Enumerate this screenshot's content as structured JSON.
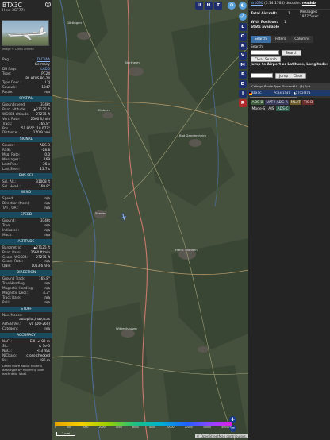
{
  "left_panel": {
    "callsign": "BTX3C",
    "hex_label": "Hex:",
    "hex": "3CF774",
    "photo_credit": "Image © Lukas Schmid",
    "rows_top": [
      {
        "k": "Reg.:",
        "v": "D-CVAA",
        "link": true
      },
      {
        "k": "",
        "v": "Germany"
      },
      {
        "k": "DB flags:",
        "v": "LADD",
        "link": true
      },
      {
        "k": "Type:",
        "v": "PC24"
      },
      {
        "k": "",
        "v": "PILATUS PC-24"
      },
      {
        "k": "Type Desc.:",
        "v": "L2J"
      },
      {
        "k": "Squawk:",
        "v": "1347"
      },
      {
        "k": "Route:",
        "v": "n/a"
      }
    ],
    "sections": [
      {
        "title": "SPATIAL",
        "rows": [
          {
            "k": "Groundspeed:",
            "v": "374kt"
          },
          {
            "k": "Baro. altitude:",
            "v": "▲27125 ft"
          },
          {
            "k": "WGS84 altitude:",
            "v": "27275 ft"
          },
          {
            "k": "Vert. Rate:",
            "v": "2560 ft/min"
          },
          {
            "k": "Track:",
            "v": "165.8°"
          },
          {
            "k": "Pos.:",
            "v": "51.865°, 10.077°"
          },
          {
            "k": "Distance:",
            "v": "170.9 nmi"
          }
        ]
      },
      {
        "title": "SIGNAL",
        "rows": [
          {
            "k": "Source:",
            "v": "ADS-B"
          },
          {
            "k": "RSSI:",
            "v": "-28.8"
          },
          {
            "k": "Msg. Rate:",
            "v": "0.0"
          },
          {
            "k": "Messages:",
            "v": "169"
          },
          {
            "k": "Last Pos.:",
            "v": "25 s"
          },
          {
            "k": "Last Seen:",
            "v": "13.7 s"
          }
        ]
      },
      {
        "title": "FMS SEL",
        "rows": [
          {
            "k": "Sel. Alt.:",
            "v": "31008 ft"
          },
          {
            "k": "Sel. Head.:",
            "v": "169.8°"
          }
        ]
      },
      {
        "title": "WIND",
        "rows": [
          {
            "k": "Speed:",
            "v": "n/a"
          },
          {
            "k": "Direction (from):",
            "v": "n/a"
          },
          {
            "k": "TAT / OAT:",
            "v": "n/a"
          }
        ]
      },
      {
        "title": "SPEED",
        "rows": [
          {
            "k": "Ground:",
            "v": "374kt"
          },
          {
            "k": "True:",
            "v": "n/a"
          },
          {
            "k": "Indicated:",
            "v": "n/a"
          },
          {
            "k": "Mach:",
            "v": "n/a"
          }
        ]
      },
      {
        "title": "ALTITUDE",
        "rows": [
          {
            "k": "Barometric:",
            "v": "▲27125 ft"
          },
          {
            "k": "Baro. Rate:",
            "v": "2560 ft/min"
          },
          {
            "k": "Geom. WGS84:",
            "v": "27275 ft"
          },
          {
            "k": "Geom. Rate:",
            "v": "n/a"
          },
          {
            "k": "QNH:",
            "v": "1013.6 hPa"
          }
        ]
      },
      {
        "title": "DIRECTION",
        "rows": [
          {
            "k": "Ground Track:",
            "v": "165.8°"
          },
          {
            "k": "True Heading:",
            "v": "n/a"
          },
          {
            "k": "Magnetic Heading:",
            "v": "n/a"
          },
          {
            "k": "Magnetic Decl.:",
            "v": "4.3°"
          },
          {
            "k": "Track Rate:",
            "v": "n/a"
          },
          {
            "k": "Roll:",
            "v": "n/a"
          }
        ]
      },
      {
        "title": "STUFF",
        "rows": [
          {
            "k": "Nav. Modes:",
            "v": ""
          },
          {
            "k": "",
            "v": "autopilot,lnav,tcas"
          },
          {
            "k": "ADS-B Ver.:",
            "v": "v0 (DO-260)"
          },
          {
            "k": "Category:",
            "v": "n/a"
          }
        ]
      },
      {
        "title": "ACCURACY",
        "rows": [
          {
            "k": "NACₚ:",
            "v": "EPU < 92 m"
          },
          {
            "k": "SIL:",
            "v": "≤ 1e-5"
          },
          {
            "k": "NACᵥ:",
            "v": "< 3 m/s"
          },
          {
            "k": "NICbaro:",
            "v": "cross-checked"
          },
          {
            "k": "Rc:",
            "v": "186 m"
          }
        ]
      }
    ],
    "footer_note": "Learn more about Mode S data type by hovering over each data label."
  },
  "map": {
    "buttons_top": [
      "U",
      "H",
      "T"
    ],
    "buttons_side": [
      "L",
      "O",
      "K",
      "M",
      "P",
      "I",
      "R"
    ],
    "buttons_side2": [
      "V",
      "D"
    ],
    "legend_ticks": [
      "0",
      "500",
      "1000",
      "2000",
      "4000",
      "6000",
      "8000",
      "10000",
      "20000",
      "30000",
      "40000+"
    ],
    "scale_label": "2 nmi",
    "attribution": "© OpenStreetMap contributors.",
    "zoom_in": "+",
    "zoom_out": "−",
    "places": [
      "Göttingen",
      "Northeim",
      "Einbeck",
      "Bad Gandersheim",
      "Seesen",
      "Hann. Münden",
      "Witzenhausen"
    ]
  },
  "right_panel": {
    "decoder_link": "ar1090",
    "decoder_text": "(3.14.1768) decoder:",
    "decoder_status": "readsb",
    "stats": {
      "total_aircraft_label": "Total Aircraft:",
      "total_aircraft": "1",
      "messages_label": "Messages:",
      "messages": "1977.5/sec",
      "with_position_label": "With Position:",
      "with_position": "1",
      "stats_label": "Stats available"
    },
    "tabs": [
      "Search",
      "Filters",
      "Columns"
    ],
    "search_label": "Search:",
    "search_button": "Search",
    "clear_search_button": "Clear Search",
    "jump_label": "Jump to Airport or Latitude, Longitude:",
    "jump_button": "Jump",
    "clear_button": "Clear",
    "table_headers": [
      "",
      "Callsign",
      "Route",
      "Type",
      "Squawk",
      "Alt. (ft)",
      "Spd"
    ],
    "table_rows": [
      {
        "callsign": "BTX3C",
        "route": "",
        "type": "PC24",
        "squawk": "1347",
        "alt": "▲27125",
        "spd": "374"
      }
    ],
    "badges": [
      {
        "label": "ADS-B",
        "color": "#3a5a3a"
      },
      {
        "label": "UAT / ADS-R",
        "color": "#3a3a5a"
      },
      {
        "label": "MLAT",
        "color": "#6a5a2a"
      },
      {
        "label": "TIS-B",
        "color": "#6a2a2a"
      },
      {
        "label": "Mode-S",
        "color": "#2a2a2a"
      },
      {
        "label": "AIS",
        "color": "#2a2a2a"
      },
      {
        "label": "ADS-C",
        "color": "#2a5a4a"
      }
    ]
  }
}
